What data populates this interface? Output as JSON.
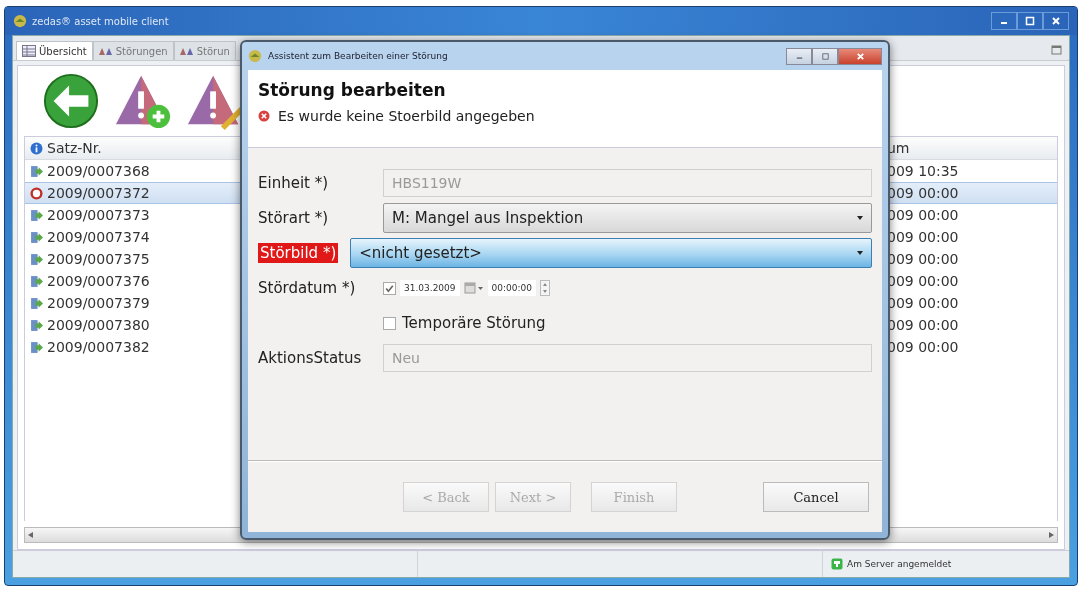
{
  "main_window": {
    "title": "zedas® asset mobile client",
    "tabs": [
      {
        "label": "Übersicht",
        "selected": true
      },
      {
        "label": "Störungen",
        "selected": false
      },
      {
        "label": "Störun",
        "selected": false
      }
    ],
    "table": {
      "columns": [
        "Satz-Nr.",
        "um"
      ],
      "rows": [
        {
          "kind": "record",
          "satz_nr": "2009/0007368",
          "column_2": "009 10:35",
          "selected": false
        },
        {
          "kind": "error",
          "satz_nr": "2009/0007372",
          "column_2": "009 00:00",
          "selected": true
        },
        {
          "kind": "record",
          "satz_nr": "2009/0007373",
          "column_2": "009 00:00",
          "selected": false
        },
        {
          "kind": "record",
          "satz_nr": "2009/0007374",
          "column_2": "009 00:00",
          "selected": false
        },
        {
          "kind": "record",
          "satz_nr": "2009/0007375",
          "column_2": "009 00:00",
          "selected": false
        },
        {
          "kind": "record",
          "satz_nr": "2009/0007376",
          "column_2": "009 00:00",
          "selected": false
        },
        {
          "kind": "record",
          "satz_nr": "2009/0007379",
          "column_2": "009 00:00",
          "selected": false
        },
        {
          "kind": "record",
          "satz_nr": "2009/0007380",
          "column_2": "009 00:00",
          "selected": false
        },
        {
          "kind": "record",
          "satz_nr": "2009/0007382",
          "column_2": "009 00:00",
          "selected": false
        }
      ]
    },
    "status_bar": {
      "text": "Am Server angemeldet"
    }
  },
  "dialog": {
    "title": "Assistent zum Bearbeiten einer Störung",
    "heading": "Störung bearbeiten",
    "error_message": "Es wurde keine Stoerbild angegeben",
    "fields": [
      {
        "kind": "text",
        "label": "Einheit *)",
        "value": "HBS119W",
        "invalid": false,
        "disabled": true
      },
      {
        "kind": "select",
        "label": "Störart *)",
        "value": "M: Mangel aus Inspektion",
        "invalid": false,
        "focused": false
      },
      {
        "kind": "select",
        "label": "Störbild *)",
        "value": "<nicht gesetzt>",
        "invalid": true,
        "focused": true
      },
      {
        "kind": "datetime",
        "label": "Stördatum *)",
        "checked": true,
        "date": "31.03.2009",
        "time": "00:00:00",
        "invalid": false
      },
      {
        "kind": "checkbox",
        "label": "Temporäre Störung",
        "checked": false
      },
      {
        "kind": "text",
        "label": "AktionsStatus",
        "value": "Neu",
        "invalid": false,
        "disabled": true
      }
    ],
    "buttons": [
      {
        "label": "< Back",
        "disabled": true
      },
      {
        "label": "Next >",
        "disabled": true
      },
      {
        "label": "Finish",
        "disabled": true
      },
      {
        "label": "Cancel",
        "disabled": false
      }
    ]
  }
}
